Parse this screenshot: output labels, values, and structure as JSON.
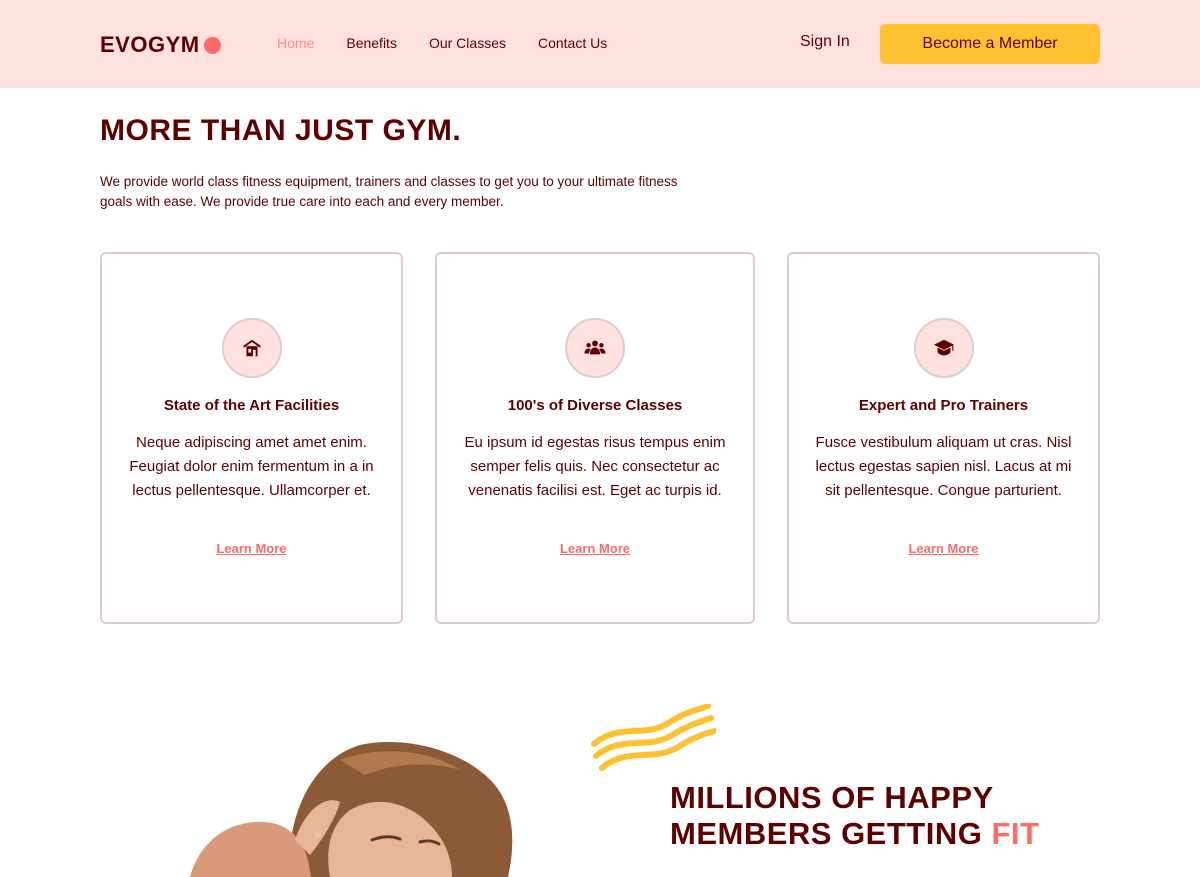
{
  "brand": {
    "name": "EVOGYM",
    "colors": {
      "primary": "#5E0000",
      "accent": "#FF6B66",
      "highlight": "#FFC132",
      "nav_bg": "#FFE1E0"
    }
  },
  "nav": {
    "links": [
      {
        "label": "Home",
        "active": true
      },
      {
        "label": "Benefits",
        "active": false
      },
      {
        "label": "Our Classes",
        "active": false
      },
      {
        "label": "Contact Us",
        "active": false
      }
    ],
    "sign_in": "Sign In",
    "cta": "Become a Member"
  },
  "benefits": {
    "headline": "MORE THAN JUST GYM.",
    "lead": "We provide world class fitness equipment, trainers and classes to get you to your ultimate fitness goals with ease. We provide true care into each and every member.",
    "cards": [
      {
        "icon": "home-building-icon",
        "title": "State of the Art Facilities",
        "body": "Neque adipiscing amet amet enim. Feugiat dolor enim fermentum in a in lectus pellentesque. Ullamcorper et.",
        "link": "Learn More"
      },
      {
        "icon": "user-group-icon",
        "title": "100's of Diverse Classes",
        "body": "Eu ipsum id egestas risus tempus enim semper felis quis. Nec consectetur ac venenatis facilisi est. Eget ac turpis id.",
        "link": "Learn More"
      },
      {
        "icon": "graduation-cap-icon",
        "title": "Expert and Pro Trainers",
        "body": "Fusce vestibulum aliquam ut cras. Nisl lectus egestas sapien nisl. Lacus at mi sit pellentesque. Congue parturient.",
        "link": "Learn More"
      }
    ]
  },
  "graphic": {
    "title_line1": "MILLIONS OF HAPPY",
    "title_line2": "MEMBERS GETTING",
    "title_highlight": "FIT"
  }
}
